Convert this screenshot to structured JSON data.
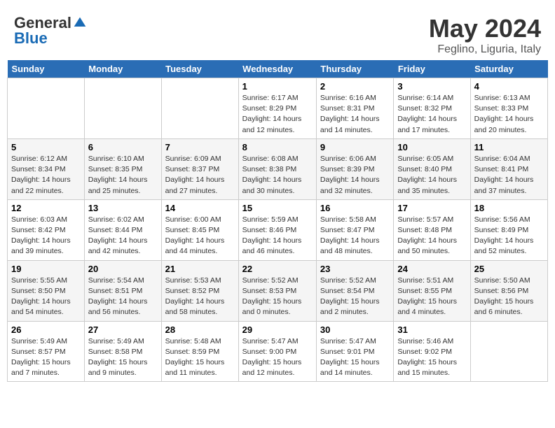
{
  "logo": {
    "general": "General",
    "blue": "Blue"
  },
  "header": {
    "month": "May 2024",
    "location": "Feglino, Liguria, Italy"
  },
  "weekdays": [
    "Sunday",
    "Monday",
    "Tuesday",
    "Wednesday",
    "Thursday",
    "Friday",
    "Saturday"
  ],
  "weeks": [
    [
      {
        "day": "",
        "info": ""
      },
      {
        "day": "",
        "info": ""
      },
      {
        "day": "",
        "info": ""
      },
      {
        "day": "1",
        "info": "Sunrise: 6:17 AM\nSunset: 8:29 PM\nDaylight: 14 hours\nand 12 minutes."
      },
      {
        "day": "2",
        "info": "Sunrise: 6:16 AM\nSunset: 8:31 PM\nDaylight: 14 hours\nand 14 minutes."
      },
      {
        "day": "3",
        "info": "Sunrise: 6:14 AM\nSunset: 8:32 PM\nDaylight: 14 hours\nand 17 minutes."
      },
      {
        "day": "4",
        "info": "Sunrise: 6:13 AM\nSunset: 8:33 PM\nDaylight: 14 hours\nand 20 minutes."
      }
    ],
    [
      {
        "day": "5",
        "info": "Sunrise: 6:12 AM\nSunset: 8:34 PM\nDaylight: 14 hours\nand 22 minutes."
      },
      {
        "day": "6",
        "info": "Sunrise: 6:10 AM\nSunset: 8:35 PM\nDaylight: 14 hours\nand 25 minutes."
      },
      {
        "day": "7",
        "info": "Sunrise: 6:09 AM\nSunset: 8:37 PM\nDaylight: 14 hours\nand 27 minutes."
      },
      {
        "day": "8",
        "info": "Sunrise: 6:08 AM\nSunset: 8:38 PM\nDaylight: 14 hours\nand 30 minutes."
      },
      {
        "day": "9",
        "info": "Sunrise: 6:06 AM\nSunset: 8:39 PM\nDaylight: 14 hours\nand 32 minutes."
      },
      {
        "day": "10",
        "info": "Sunrise: 6:05 AM\nSunset: 8:40 PM\nDaylight: 14 hours\nand 35 minutes."
      },
      {
        "day": "11",
        "info": "Sunrise: 6:04 AM\nSunset: 8:41 PM\nDaylight: 14 hours\nand 37 minutes."
      }
    ],
    [
      {
        "day": "12",
        "info": "Sunrise: 6:03 AM\nSunset: 8:42 PM\nDaylight: 14 hours\nand 39 minutes."
      },
      {
        "day": "13",
        "info": "Sunrise: 6:02 AM\nSunset: 8:44 PM\nDaylight: 14 hours\nand 42 minutes."
      },
      {
        "day": "14",
        "info": "Sunrise: 6:00 AM\nSunset: 8:45 PM\nDaylight: 14 hours\nand 44 minutes."
      },
      {
        "day": "15",
        "info": "Sunrise: 5:59 AM\nSunset: 8:46 PM\nDaylight: 14 hours\nand 46 minutes."
      },
      {
        "day": "16",
        "info": "Sunrise: 5:58 AM\nSunset: 8:47 PM\nDaylight: 14 hours\nand 48 minutes."
      },
      {
        "day": "17",
        "info": "Sunrise: 5:57 AM\nSunset: 8:48 PM\nDaylight: 14 hours\nand 50 minutes."
      },
      {
        "day": "18",
        "info": "Sunrise: 5:56 AM\nSunset: 8:49 PM\nDaylight: 14 hours\nand 52 minutes."
      }
    ],
    [
      {
        "day": "19",
        "info": "Sunrise: 5:55 AM\nSunset: 8:50 PM\nDaylight: 14 hours\nand 54 minutes."
      },
      {
        "day": "20",
        "info": "Sunrise: 5:54 AM\nSunset: 8:51 PM\nDaylight: 14 hours\nand 56 minutes."
      },
      {
        "day": "21",
        "info": "Sunrise: 5:53 AM\nSunset: 8:52 PM\nDaylight: 14 hours\nand 58 minutes."
      },
      {
        "day": "22",
        "info": "Sunrise: 5:52 AM\nSunset: 8:53 PM\nDaylight: 15 hours\nand 0 minutes."
      },
      {
        "day": "23",
        "info": "Sunrise: 5:52 AM\nSunset: 8:54 PM\nDaylight: 15 hours\nand 2 minutes."
      },
      {
        "day": "24",
        "info": "Sunrise: 5:51 AM\nSunset: 8:55 PM\nDaylight: 15 hours\nand 4 minutes."
      },
      {
        "day": "25",
        "info": "Sunrise: 5:50 AM\nSunset: 8:56 PM\nDaylight: 15 hours\nand 6 minutes."
      }
    ],
    [
      {
        "day": "26",
        "info": "Sunrise: 5:49 AM\nSunset: 8:57 PM\nDaylight: 15 hours\nand 7 minutes."
      },
      {
        "day": "27",
        "info": "Sunrise: 5:49 AM\nSunset: 8:58 PM\nDaylight: 15 hours\nand 9 minutes."
      },
      {
        "day": "28",
        "info": "Sunrise: 5:48 AM\nSunset: 8:59 PM\nDaylight: 15 hours\nand 11 minutes."
      },
      {
        "day": "29",
        "info": "Sunrise: 5:47 AM\nSunset: 9:00 PM\nDaylight: 15 hours\nand 12 minutes."
      },
      {
        "day": "30",
        "info": "Sunrise: 5:47 AM\nSunset: 9:01 PM\nDaylight: 15 hours\nand 14 minutes."
      },
      {
        "day": "31",
        "info": "Sunrise: 5:46 AM\nSunset: 9:02 PM\nDaylight: 15 hours\nand 15 minutes."
      },
      {
        "day": "",
        "info": ""
      }
    ]
  ]
}
